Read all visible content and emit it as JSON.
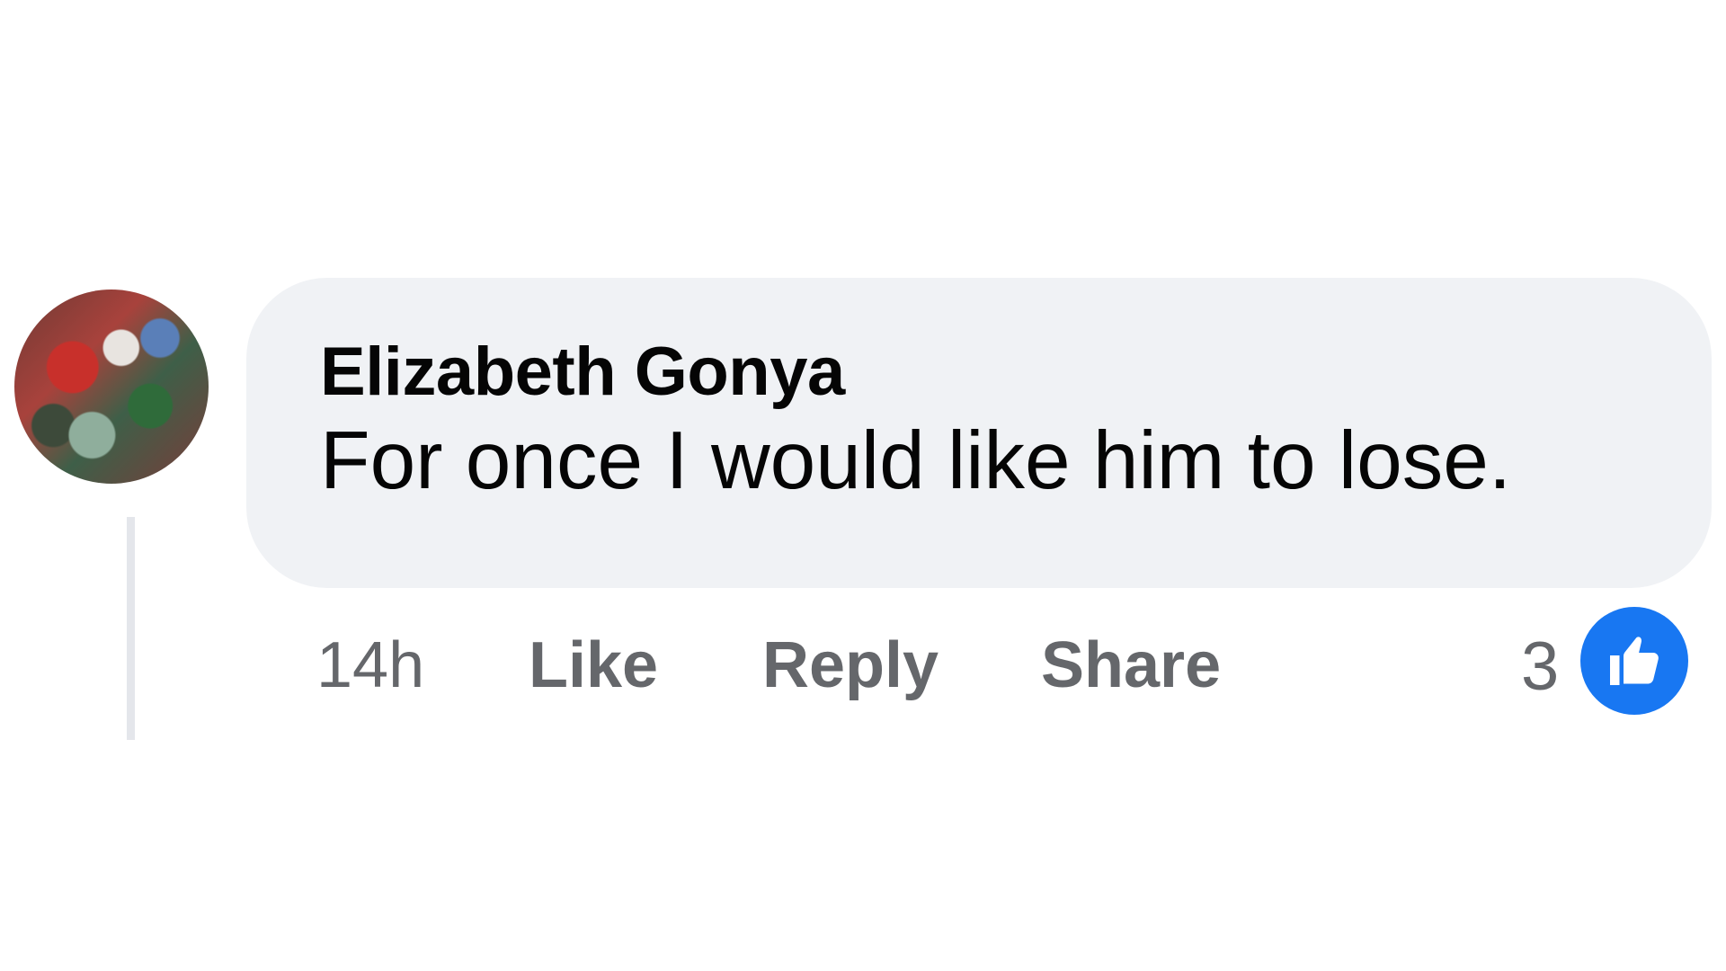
{
  "comment": {
    "author": "Elizabeth Gonya",
    "text": "For once I would like him to lose.",
    "timestamp": "14h",
    "actions": {
      "like": "Like",
      "reply": "Reply",
      "share": "Share"
    },
    "reactions": {
      "count": "3",
      "icon": "thumbs-up-icon",
      "color": "#1877f2"
    }
  }
}
